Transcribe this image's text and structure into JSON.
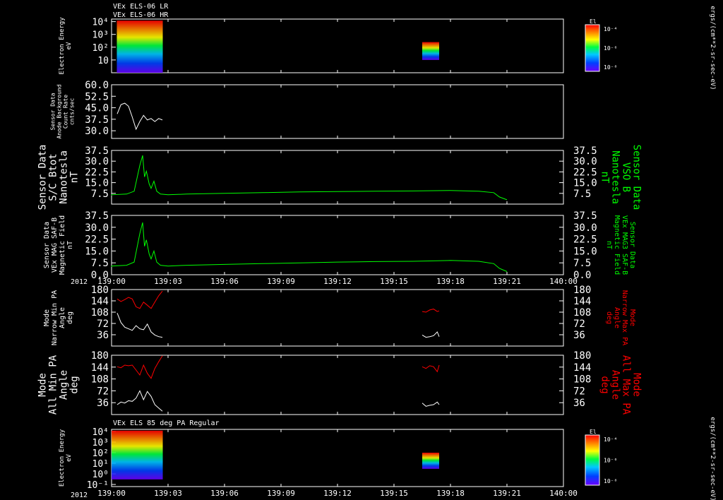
{
  "header": {
    "line1": "VEx ELS-06 LR",
    "line2": "VEx ELS-06 HR",
    "panel7_title": "VEx ELS 85 deg PA Regular"
  },
  "colorbar": {
    "title": "El",
    "unit": "ergs/(cm**2-sr-sec-eV)",
    "ticks": [
      "10⁻⁴",
      "10⁻⁶",
      "10⁻⁸"
    ]
  },
  "time_axis": {
    "year": "2012",
    "ticks": [
      "139:00",
      "139:03",
      "139:06",
      "139:09",
      "139:12",
      "139:15",
      "139:18",
      "139:21",
      "140:00"
    ]
  },
  "colors": {
    "white": "#ffffff",
    "green": "#00ff00",
    "red": "#ff0000"
  },
  "chart_data": [
    {
      "type": "heatmap",
      "label_left": [
        "Electron Energy",
        "eV"
      ],
      "y_ticks": [
        "10⁴",
        "10³",
        "10²",
        "10"
      ],
      "log_min": 0,
      "log_max": 4.2,
      "blocks": [
        {
          "t_start": 0.28,
          "t_end": 2.72,
          "e_low": 1.0,
          "e_high": 12000
        },
        {
          "t_start": 16.5,
          "t_end": 17.4,
          "e_low": 10,
          "e_high": 250
        }
      ]
    },
    {
      "type": "line",
      "label_left": [
        "Sensor Data",
        "Anode Background",
        "Count Rate",
        "cnts/sec"
      ],
      "ylim": [
        25,
        60
      ],
      "y_ticks": [
        30.0,
        37.5,
        45.0,
        52.5,
        60.0
      ],
      "series": [
        {
          "color": "white",
          "x": [
            0.3,
            0.5,
            0.7,
            0.9,
            1.1,
            1.3,
            1.5,
            1.7,
            1.9,
            2.1,
            2.3,
            2.5,
            2.7
          ],
          "y": [
            41,
            47,
            48,
            46,
            39,
            31,
            36,
            40,
            37,
            38,
            36,
            38,
            37
          ]
        }
      ]
    },
    {
      "type": "line",
      "label_left": [
        "Sensor Data",
        "S/C Btot",
        "Nanotesla",
        "nT"
      ],
      "label_right": [
        "Sensor Data",
        "VSO B",
        "Nanotesla",
        "nT"
      ],
      "ylim": [
        0,
        37.5
      ],
      "y_ticks": [
        7.5,
        15.0,
        22.5,
        30.0,
        37.5
      ],
      "series": [
        {
          "color": "green",
          "x": [
            -3.0,
            -2.0,
            -1.0,
            0.0,
            0.8,
            1.2,
            1.5,
            1.65,
            1.75,
            1.85,
            2.0,
            2.1,
            2.25,
            2.4,
            2.6,
            3.0,
            4.0,
            6.0,
            8.0,
            10.0,
            12.0,
            14.0,
            16.0,
            18.0,
            19.5,
            20.3,
            20.6,
            21.0
          ],
          "y": [
            6,
            6.5,
            6,
            6.5,
            7,
            9,
            27,
            34,
            19,
            23,
            14,
            11,
            16,
            9,
            7,
            6.5,
            7,
            7.5,
            8,
            8.5,
            8.8,
            9,
            9.2,
            9.5,
            9,
            8,
            5,
            3
          ]
        }
      ]
    },
    {
      "type": "line",
      "label_left": [
        "Sensor Data",
        "VEx MAG SAF-B",
        "Magnetic Field",
        "nT"
      ],
      "label_right": [
        "Sensor Data",
        "VEx MAG3 SAF-B",
        "Magnetic Field",
        "nT"
      ],
      "ylim": [
        0,
        37.5
      ],
      "y_ticks": [
        0.0,
        7.5,
        15.0,
        22.5,
        30.0,
        37.5
      ],
      "series": [
        {
          "color": "green",
          "x": [
            -3.0,
            -2.0,
            -1.0,
            0.0,
            0.8,
            1.2,
            1.5,
            1.65,
            1.75,
            1.85,
            2.0,
            2.1,
            2.25,
            2.4,
            2.6,
            3.0,
            4.0,
            6.0,
            8.0,
            10.0,
            12.0,
            14.0,
            16.0,
            18.0,
            19.5,
            20.3,
            20.6,
            21.0
          ],
          "y": [
            5,
            5.5,
            5,
            5.5,
            6,
            8,
            26,
            33,
            18,
            22,
            13,
            10,
            15,
            8,
            6,
            5.5,
            6,
            6.5,
            7,
            7.5,
            8,
            8.3,
            8.5,
            9,
            8.5,
            7,
            4,
            2
          ]
        }
      ]
    },
    {
      "type": "line",
      "label_left": [
        "Mode",
        "Narrow Min PA",
        "Angle",
        "deg"
      ],
      "label_right": [
        "Mode",
        "Narrow Max PA",
        "Angle",
        "deg"
      ],
      "ylim": [
        0,
        180
      ],
      "y_ticks": [
        36,
        72,
        108,
        144,
        180
      ],
      "series": [
        {
          "color": "red",
          "x": [
            0.3,
            0.5,
            0.7,
            0.9,
            1.1,
            1.3,
            1.5,
            1.7,
            1.9,
            2.1,
            2.3,
            2.5,
            2.7
          ],
          "y": [
            150,
            142,
            148,
            155,
            150,
            125,
            120,
            140,
            130,
            120,
            140,
            160,
            175
          ]
        },
        {
          "color": "white",
          "x": [
            0.3,
            0.5,
            0.7,
            0.9,
            1.1,
            1.3,
            1.5,
            1.7,
            1.9,
            2.1,
            2.3,
            2.5,
            2.7
          ],
          "y": [
            105,
            75,
            60,
            55,
            50,
            65,
            55,
            52,
            70,
            45,
            35,
            30,
            28
          ]
        },
        {
          "color": "red",
          "x": [
            16.5,
            16.7,
            16.9,
            17.1,
            17.3,
            17.4
          ],
          "y": [
            110,
            108,
            115,
            118,
            110,
            112
          ]
        },
        {
          "color": "white",
          "x": [
            16.5,
            16.7,
            16.9,
            17.1,
            17.3,
            17.4
          ],
          "y": [
            35,
            28,
            30,
            33,
            45,
            30
          ]
        }
      ]
    },
    {
      "type": "line",
      "label_left": [
        "Mode",
        "All Min PA",
        "Angle",
        "deg"
      ],
      "label_right": [
        "Mode",
        "All Max PA",
        "Angle",
        "deg"
      ],
      "ylim": [
        0,
        180
      ],
      "y_ticks": [
        36,
        72,
        108,
        144,
        180
      ],
      "series": [
        {
          "color": "red",
          "x": [
            0.3,
            0.5,
            0.7,
            0.9,
            1.1,
            1.3,
            1.5,
            1.7,
            1.9,
            2.1,
            2.3,
            2.5,
            2.7
          ],
          "y": [
            145,
            142,
            150,
            148,
            150,
            135,
            120,
            150,
            125,
            110,
            140,
            160,
            178
          ]
        },
        {
          "color": "white",
          "x": [
            0.3,
            0.5,
            0.7,
            0.9,
            1.1,
            1.3,
            1.5,
            1.7,
            1.9,
            2.1,
            2.3,
            2.5,
            2.7
          ],
          "y": [
            30,
            38,
            35,
            42,
            40,
            50,
            72,
            45,
            70,
            55,
            30,
            20,
            10
          ]
        },
        {
          "color": "red",
          "x": [
            16.5,
            16.7,
            16.9,
            17.1,
            17.3,
            17.4
          ],
          "y": [
            145,
            140,
            148,
            145,
            130,
            150
          ]
        },
        {
          "color": "white",
          "x": [
            16.5,
            16.7,
            16.9,
            17.1,
            17.3,
            17.4
          ],
          "y": [
            35,
            25,
            28,
            30,
            38,
            30
          ]
        }
      ]
    },
    {
      "type": "heatmap",
      "label_left": [
        "Electron Energy",
        "eV"
      ],
      "y_ticks": [
        "10⁴",
        "10³",
        "10²",
        "10¹",
        "10⁰",
        "10⁻¹"
      ],
      "log_min": -1.2,
      "log_max": 4.2,
      "blocks": [
        {
          "t_start": 0.0,
          "t_end": 2.72,
          "e_low": 0.3,
          "e_high": 12000
        },
        {
          "t_start": 16.5,
          "t_end": 17.4,
          "e_low": 3,
          "e_high": 100
        }
      ]
    }
  ]
}
